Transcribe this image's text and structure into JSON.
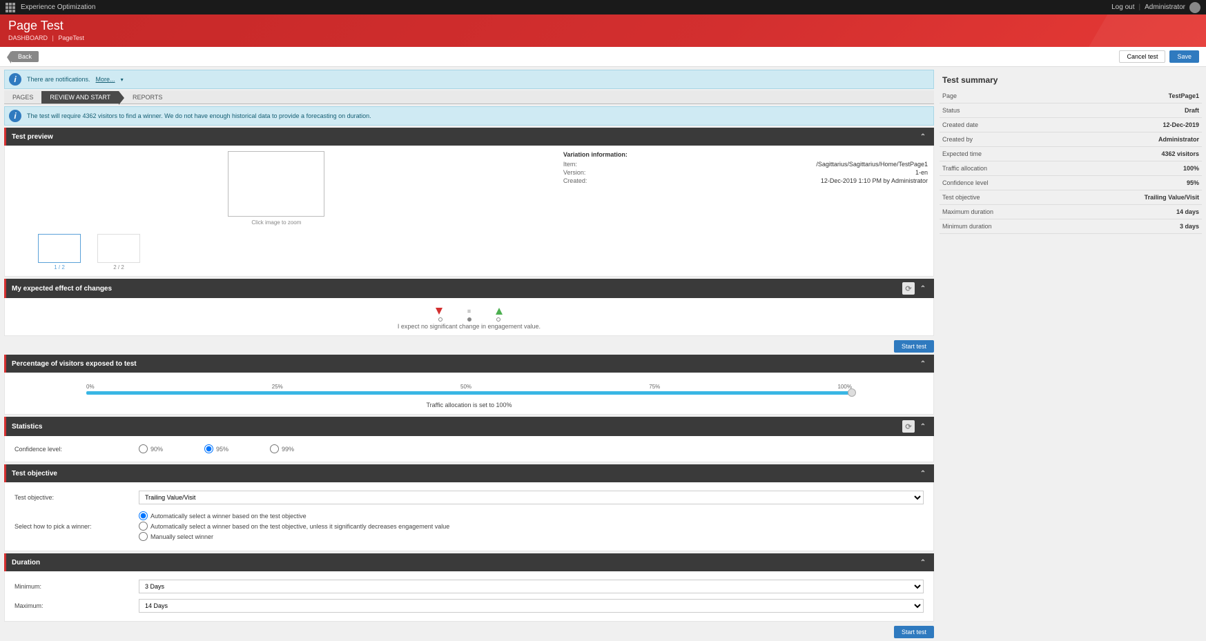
{
  "topbar": {
    "app": "Experience Optimization",
    "logout": "Log out",
    "user": "Administrator"
  },
  "header": {
    "title": "Page Test",
    "crumb1": "DASHBOARD",
    "crumb2": "PageTest"
  },
  "actions": {
    "back": "Back",
    "cancel": "Cancel test",
    "save": "Save"
  },
  "notif1": {
    "text": "There are notifications.",
    "more": "More..."
  },
  "tabs": {
    "pages": "PAGES",
    "review": "REVIEW AND START",
    "reports": "REPORTS"
  },
  "notif2": {
    "text": "The test will require 4362 visitors to find a winner. We do not have enough historical data to provide a forecasting on duration."
  },
  "preview": {
    "title": "Test preview",
    "caption": "Click image to zoom",
    "thumb1": "1 / 2",
    "thumb2": "2 / 2",
    "varinfo": "Variation information:",
    "item_k": "Item:",
    "item_v": "/Sagittarius/Sagittarius/Home/TestPage1",
    "ver_k": "Version:",
    "ver_v": "1-en",
    "cre_k": "Created:",
    "cre_v": "12-Dec-2019 1:10 PM by Administrator"
  },
  "effect": {
    "title": "My expected effect of changes",
    "note": "I expect no significant change in engagement value."
  },
  "start_label": "Start test",
  "traffic": {
    "title": "Percentage of visitors exposed to test",
    "t0": "0%",
    "t25": "25%",
    "t50": "50%",
    "t75": "75%",
    "t100": "100%",
    "note": "Traffic allocation is set to 100%"
  },
  "stats": {
    "title": "Statistics",
    "label": "Confidence level:",
    "r90": "90%",
    "r95": "95%",
    "r99": "99%"
  },
  "objective": {
    "title": "Test objective",
    "obj_lbl": "Test objective:",
    "obj_val": "Trailing Value/Visit",
    "winner_lbl": "Select how to pick a winner:",
    "opt1": "Automatically select a winner based on the test objective",
    "opt2": "Automatically select a winner based on the test objective, unless it significantly decreases engagement value",
    "opt3": "Manually select winner"
  },
  "duration": {
    "title": "Duration",
    "min_lbl": "Minimum:",
    "min_val": "3 Days",
    "max_lbl": "Maximum:",
    "max_val": "14 Days"
  },
  "summary": {
    "title": "Test summary",
    "rows": [
      {
        "k": "Page",
        "v": "TestPage1"
      },
      {
        "k": "Status",
        "v": "Draft"
      },
      {
        "k": "Created date",
        "v": "12-Dec-2019"
      },
      {
        "k": "Created by",
        "v": "Administrator"
      },
      {
        "k": "Expected time",
        "v": "4362 visitors"
      },
      {
        "k": "Traffic allocation",
        "v": "100%"
      },
      {
        "k": "Confidence level",
        "v": "95%"
      },
      {
        "k": "Test objective",
        "v": "Trailing Value/Visit"
      },
      {
        "k": "Maximum duration",
        "v": "14 days"
      },
      {
        "k": "Minimum duration",
        "v": "3 days"
      }
    ]
  }
}
